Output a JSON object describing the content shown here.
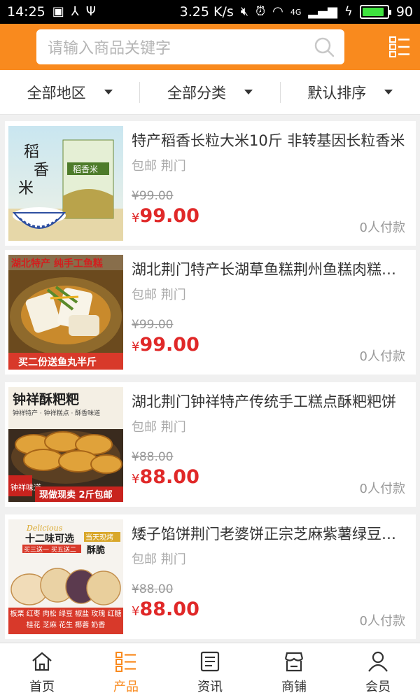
{
  "status": {
    "time": "14:25",
    "speed": "3.25 K/s",
    "network": "4G",
    "battery": "90",
    "battery_level": 0.9
  },
  "search": {
    "placeholder": "请输入商品关键字"
  },
  "filters": [
    {
      "label": "全部地区"
    },
    {
      "label": "全部分类"
    },
    {
      "label": "默认排序"
    }
  ],
  "products": [
    {
      "title": "特产稻香长粒大米10斤 非转基因长粒香米",
      "shipping": "包邮",
      "city": "荆门",
      "old_price": "¥99.00",
      "currency": "¥",
      "price": "99.00",
      "paid": "0人付款",
      "thumb_texts": [
        "稻",
        "香",
        "米",
        "稻香米"
      ]
    },
    {
      "title": "湖北荆门特产长湖草鱼糕荆州鱼糕肉糕手工",
      "shipping": "包邮",
      "city": "荆门",
      "old_price": "¥99.00",
      "currency": "¥",
      "price": "99.00",
      "paid": "0人付款",
      "thumb_texts": [
        "湖北特产 纯手工鱼糕",
        "买二份送鱼丸半斤"
      ]
    },
    {
      "title": "湖北荆门钟祥特产传统手工糕点酥粑粑饼",
      "shipping": "包邮",
      "city": "荆门",
      "old_price": "¥88.00",
      "currency": "¥",
      "price": "88.00",
      "paid": "0人付款",
      "thumb_texts": [
        "钟祥酥粑粑",
        "钟祥特产 · 钟祥糕点 · 酥香味道",
        "钟祥味道",
        "现做现卖 2斤包邮"
      ]
    },
    {
      "title": "矮子馅饼荆门老婆饼正宗芝麻紫薯绿豆酥饼",
      "shipping": "包邮",
      "city": "荆门",
      "old_price": "¥88.00",
      "currency": "¥",
      "price": "88.00",
      "paid": "0人付款",
      "thumb_texts": [
        "Delicious",
        "十二味可选",
        "买三送一 买五送二",
        "当天现烤",
        "酥脆",
        "板栗 红枣 肉松 绿豆 椒盐 玫瑰 红糖 桂花 芝麻 花生 椰蓉 奶香"
      ]
    }
  ],
  "tabs": [
    {
      "label": "首页",
      "icon": "home-icon"
    },
    {
      "label": "产品",
      "icon": "product-list-icon",
      "active": true
    },
    {
      "label": "资讯",
      "icon": "news-icon"
    },
    {
      "label": "商铺",
      "icon": "store-icon"
    },
    {
      "label": "会员",
      "icon": "member-icon"
    }
  ],
  "colors": {
    "accent": "#f98a1e",
    "price": "#e02828"
  }
}
